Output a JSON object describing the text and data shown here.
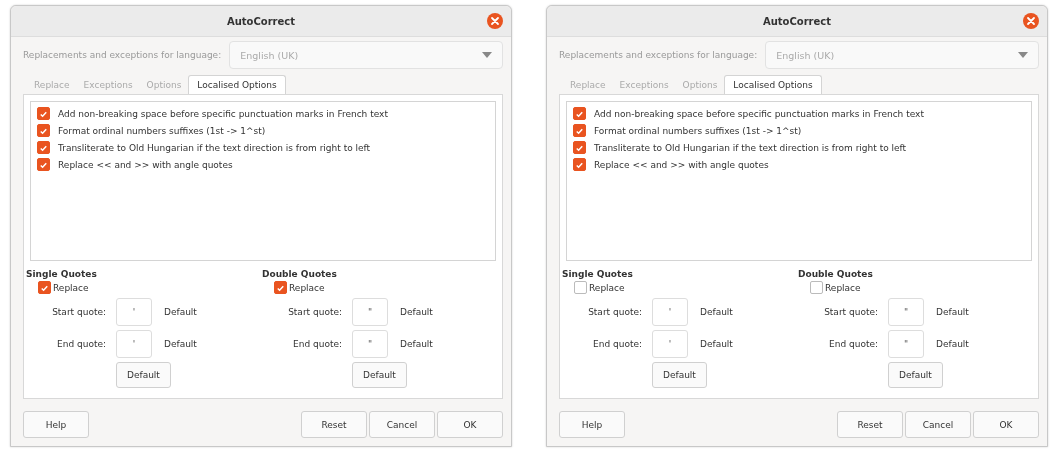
{
  "dialogs": [
    {
      "title": "AutoCorrect",
      "language_label": "Replacements and exceptions for language:",
      "language": "English (UK)",
      "tabs": [
        {
          "label": "Replace",
          "selected": false
        },
        {
          "label": "Exceptions",
          "selected": false
        },
        {
          "label": "Options",
          "selected": false
        },
        {
          "label": "Localised Options",
          "selected": true
        }
      ],
      "options": [
        {
          "label": "Add non-breaking space before specific punctuation marks in French text",
          "checked": true
        },
        {
          "label": "Format ordinal numbers suffixes (1st -> 1^st)",
          "checked": true
        },
        {
          "label": "Transliterate to Old Hungarian if the text direction is from right to left",
          "checked": true
        },
        {
          "label": "Replace << and >> with angle quotes",
          "checked": true
        }
      ],
      "quote_groups": [
        {
          "heading": "Single Quotes",
          "replace_label": "Replace",
          "replace_checked": true,
          "start_label": "Start quote:",
          "start_value": "'",
          "start_note": "Default",
          "end_label": "End quote:",
          "end_value": "'",
          "end_note": "Default",
          "default_button": "Default"
        },
        {
          "heading": "Double Quotes",
          "replace_label": "Replace",
          "replace_checked": true,
          "start_label": "Start quote:",
          "start_value": "\"",
          "start_note": "Default",
          "end_label": "End quote:",
          "end_value": "\"",
          "end_note": "Default",
          "default_button": "Default"
        }
      ],
      "buttons": {
        "help": "Help",
        "actions": [
          "Reset",
          "Cancel",
          "OK"
        ]
      }
    },
    {
      "title": "AutoCorrect",
      "language_label": "Replacements and exceptions for language:",
      "language": "English (UK)",
      "tabs": [
        {
          "label": "Replace",
          "selected": false
        },
        {
          "label": "Exceptions",
          "selected": false
        },
        {
          "label": "Options",
          "selected": false
        },
        {
          "label": "Localised Options",
          "selected": true
        }
      ],
      "options": [
        {
          "label": "Add non-breaking space before specific punctuation marks in French text",
          "checked": true
        },
        {
          "label": "Format ordinal numbers suffixes (1st -> 1^st)",
          "checked": true
        },
        {
          "label": "Transliterate to Old Hungarian if the text direction is from right to left",
          "checked": true
        },
        {
          "label": "Replace << and >> with angle quotes",
          "checked": true
        }
      ],
      "quote_groups": [
        {
          "heading": "Single Quotes",
          "replace_label": "Replace",
          "replace_checked": false,
          "start_label": "Start quote:",
          "start_value": "'",
          "start_note": "Default",
          "end_label": "End quote:",
          "end_value": "'",
          "end_note": "Default",
          "default_button": "Default"
        },
        {
          "heading": "Double Quotes",
          "replace_label": "Replace",
          "replace_checked": false,
          "start_label": "Start quote:",
          "start_value": "\"",
          "start_note": "Default",
          "end_label": "End quote:",
          "end_value": "\"",
          "end_note": "Default",
          "default_button": "Default"
        }
      ],
      "buttons": {
        "help": "Help",
        "actions": [
          "Reset",
          "Cancel",
          "OK"
        ]
      }
    }
  ]
}
